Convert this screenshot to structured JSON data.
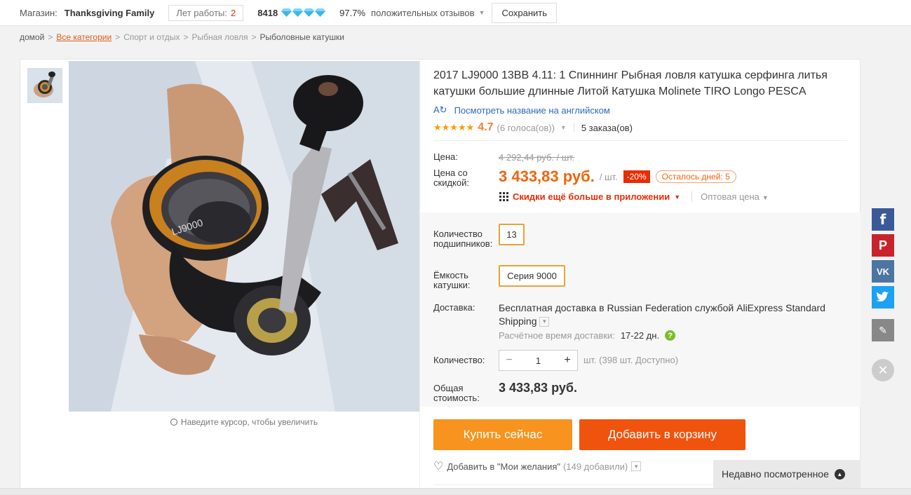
{
  "store_bar": {
    "store_label": "Магазин:",
    "store_name": "Thanksgiving Family",
    "years_label": "Лет работы:",
    "years_value": "2",
    "score": "8418",
    "feedback_percent": "97.7%",
    "feedback_text": "положительных отзывов",
    "save_label": "Сохранить",
    "diamond_color": "#3ab6e8"
  },
  "breadcrumb": {
    "home": "домой",
    "all_categories": "Все категории",
    "sport": "Спорт и отдых",
    "fishing": "Рыбная ловля",
    "current": "Рыболовные катушки",
    "separator": ">"
  },
  "gallery": {
    "zoom_hint": "Наведите курсор, чтобы увеличить",
    "image_alt": "fishing-reel-in-hand"
  },
  "product": {
    "title": "2017 LJ9000 13BB 4.11: 1 Спиннинг Рыбная ловля катушка серфинга литья катушки большие длинные Литой Катушка Molinete TIRO Longo PESCA",
    "translate_link": "Посмотреть название на английском",
    "rating": "4.7",
    "votes": "(6 голоса(ов))",
    "orders": "5 заказа(ов)"
  },
  "price": {
    "price_label": "Цена:",
    "old_price": "4 292,44 руб. / шт.",
    "discount_label": "Цена со скидкой:",
    "new_price": "3 433,83 руб.",
    "unit": "/ шт.",
    "discount_badge": "-20%",
    "days_left": "Осталось дней: 5",
    "app_discount": "Скидки ещё больше в приложении",
    "wholesale": "Оптовая цена"
  },
  "options": {
    "bearings_label": "Количество подшипников:",
    "bearings_value": "13",
    "capacity_label": "Ёмкость катушки:",
    "capacity_value": "Серия 9000",
    "shipping_label": "Доставка:",
    "shipping_text": "Бесплатная доставка в Russian Federation службой AliExpress Standard Shipping",
    "eta_label": "Расчётное время доставки:",
    "eta_value": "17-22 дн.",
    "quantity_label": "Количество:",
    "quantity_value": "1",
    "available": "шт. (398 шт. Доступно)",
    "total_label": "Общая стоимость:",
    "total_value": "3 433,83 руб."
  },
  "actions": {
    "buy_now": "Купить сейчас",
    "add_to_cart": "Добавить в корзину",
    "wishlist": "Добавить в \"Мои желания\"",
    "wishlist_count": "(149 добавили)"
  },
  "recent": {
    "label": "Недавно посмотренное"
  },
  "colors": {
    "accent_orange": "#f0640a",
    "buy_button": "#f7931e",
    "cart_button": "#f0530e",
    "discount_red": "#e62e04",
    "option_border": "#e8a23b"
  }
}
